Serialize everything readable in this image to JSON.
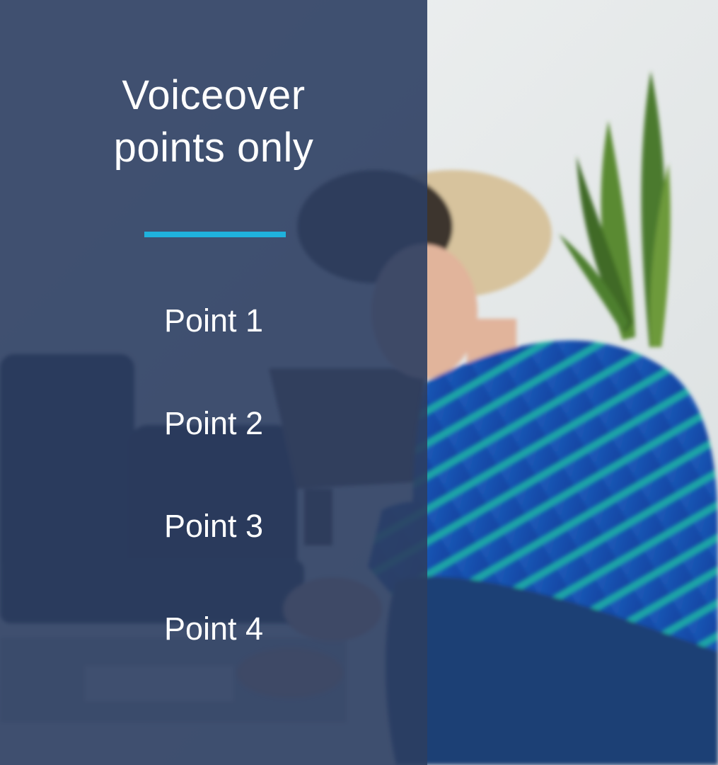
{
  "slide": {
    "title_line1": "Voiceover",
    "title_line2": "points only",
    "points": [
      "Point 1",
      "Point 2",
      "Point 3",
      "Point 4"
    ]
  },
  "colors": {
    "panel": "#2c3e62",
    "accent": "#1fb2dd",
    "text": "#ffffff"
  },
  "background_image": "photo-woman-writing-on-couch"
}
